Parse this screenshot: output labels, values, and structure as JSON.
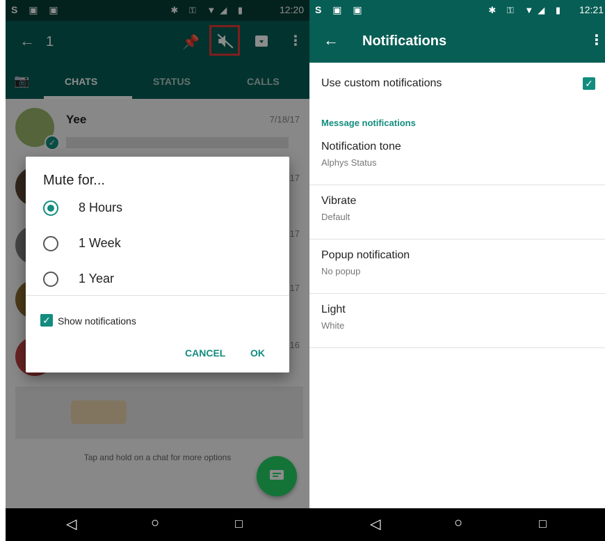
{
  "left": {
    "status": {
      "time": "12:20"
    },
    "toolbar": {
      "count": "1"
    },
    "tabs": {
      "chats": "CHATS",
      "status": "STATUS",
      "calls": "CALLS"
    },
    "chats": [
      {
        "name": "Yee",
        "date": "7/18/17"
      },
      {
        "name": "",
        "date": "17"
      },
      {
        "name": "",
        "date": "17"
      },
      {
        "name": "",
        "date": "17"
      },
      {
        "name": "",
        "date": "16"
      }
    ],
    "hint": "Tap and hold on a chat for more options",
    "dialog": {
      "title": "Mute for...",
      "options": [
        "8 Hours",
        "1 Week",
        "1 Year"
      ],
      "selected_index": 0,
      "show_notifications_label": "Show notifications",
      "show_notifications_checked": true,
      "cancel_label": "CANCEL",
      "ok_label": "OK"
    }
  },
  "right": {
    "status": {
      "time": "12:21"
    },
    "toolbar": {
      "title": "Notifications"
    },
    "custom": {
      "label": "Use custom notifications",
      "checked": true
    },
    "section_header": "Message notifications",
    "settings": [
      {
        "title": "Notification tone",
        "value": "Alphys Status"
      },
      {
        "title": "Vibrate",
        "value": "Default"
      },
      {
        "title": "Popup notification",
        "value": "No popup"
      },
      {
        "title": "Light",
        "value": "White"
      }
    ]
  },
  "colors": {
    "primary": "#075e54",
    "status_bar": "#063f37",
    "accent": "#128c7e",
    "fab": "#25d366",
    "highlight": "#e53935"
  }
}
